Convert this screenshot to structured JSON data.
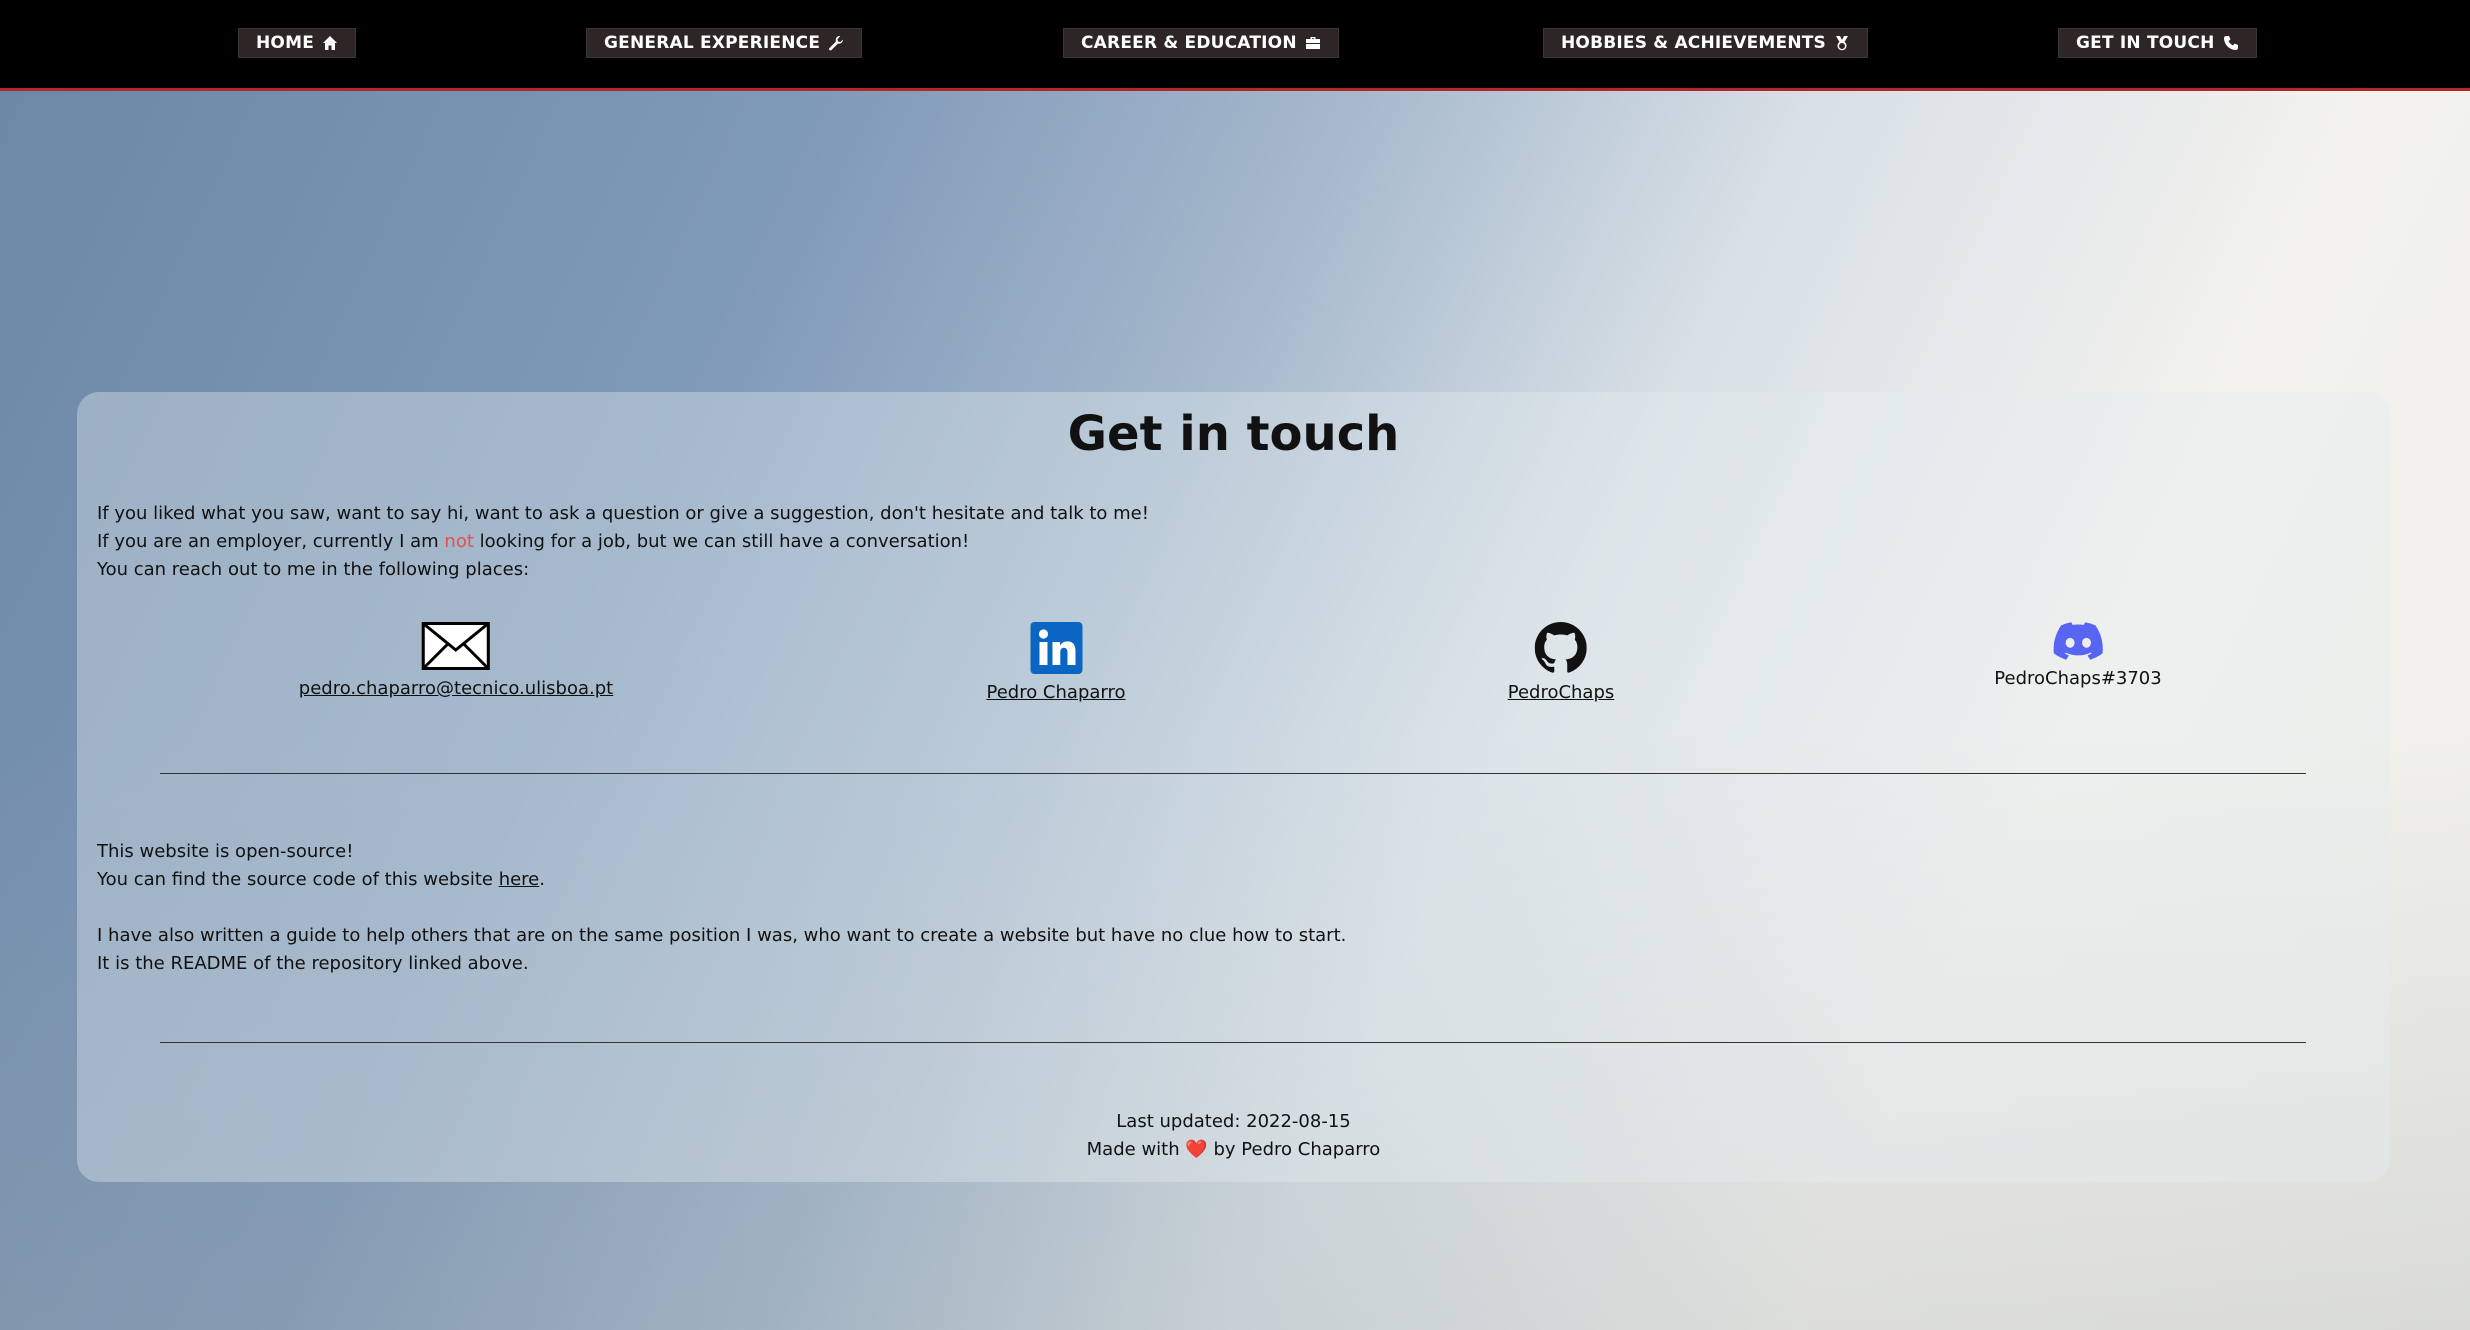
{
  "nav": {
    "items": [
      {
        "label": "HOME",
        "icon": "home-icon"
      },
      {
        "label": "GENERAL EXPERIENCE",
        "icon": "wrench-icon"
      },
      {
        "label": "CAREER & EDUCATION",
        "icon": "briefcase-icon"
      },
      {
        "label": "HOBBIES & ACHIEVEMENTS",
        "icon": "medal-icon"
      },
      {
        "label": "GET IN TOUCH",
        "icon": "phone-icon"
      }
    ],
    "accent_color": "#b3262b"
  },
  "main": {
    "title": "Get in touch",
    "intro": {
      "line1": "If you liked what you saw, want to say hi, want to ask a question or give a suggestion, don't hesitate and talk to me!",
      "line2_before": "If you are an employer, currently I am ",
      "line2_highlight": "not",
      "line2_after": " looking for a job, but we can still have a conversation!",
      "line3": "You can reach out to me in the following places:",
      "highlight_color": "#e55050"
    },
    "contacts": [
      {
        "icon": "envelope-icon",
        "label": "pedro.chaparro@tecnico.ulisboa.pt"
      },
      {
        "icon": "linkedin-icon",
        "label": "Pedro Chaparro",
        "color": "#0a66c2"
      },
      {
        "icon": "github-icon",
        "label": "PedroChaps"
      },
      {
        "icon": "discord-icon",
        "label": "PedroChaps#3703",
        "color": "#5865f2"
      }
    ],
    "opensource": {
      "line1": "This website is open-source!",
      "line2_before": "You can find the source code of this website ",
      "line2_link": "here",
      "line2_after": ".",
      "line3": "I have also written a guide to help others that are on the same position I was, who want to create a website but have no clue how to start.",
      "line4": "It is the README of the repository linked above."
    },
    "footer": {
      "updated": "Last updated: 2022-08-15",
      "made_before": "Made with ",
      "heart": "❤️",
      "made_after": " by Pedro Chaparro"
    }
  }
}
